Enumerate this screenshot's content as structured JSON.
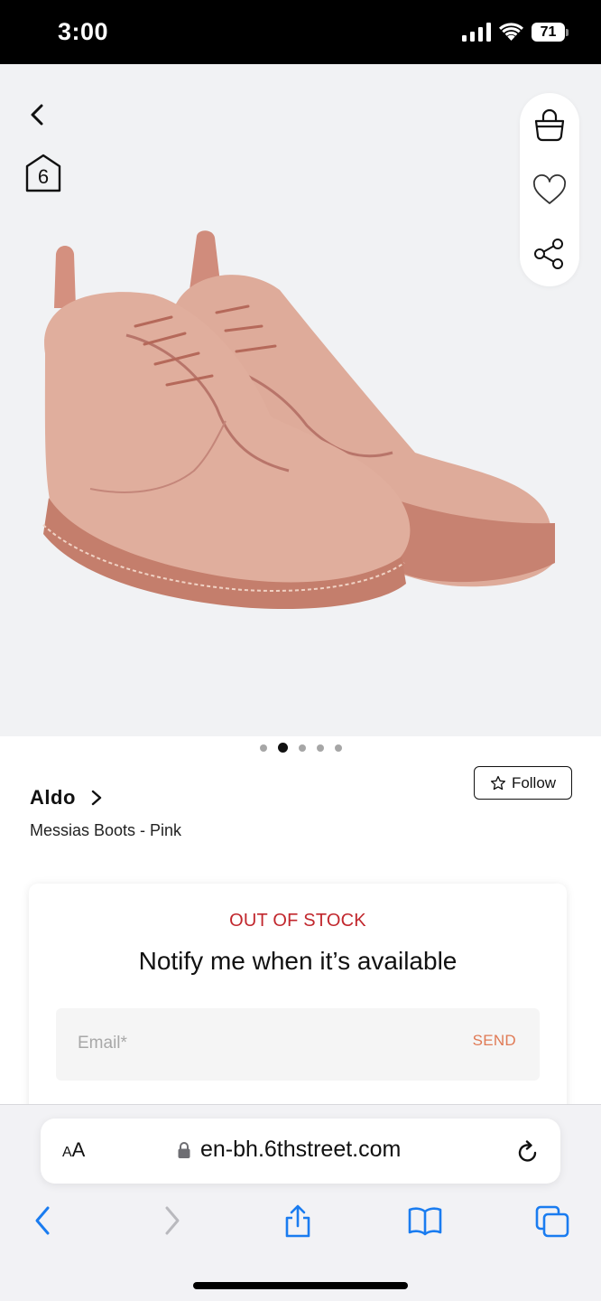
{
  "status_bar": {
    "time": "3:00",
    "battery": "71",
    "icons": [
      "signal-icon",
      "wifi-icon",
      "battery-icon"
    ]
  },
  "product_gallery": {
    "icons": [
      "back-icon",
      "6thstreet-logo-icon",
      "shopping-bag-icon",
      "heart-icon",
      "share-icon"
    ],
    "image": "pink-suede-chukka-boots",
    "pagination": {
      "total": 5,
      "active_index": 1
    }
  },
  "product": {
    "brand": "Aldo",
    "name": "Messias Boots - Pink",
    "follow_label": "Follow"
  },
  "notify": {
    "status": "OUT OF STOCK",
    "title": "Notify me when it’s available",
    "email_placeholder": "Email*",
    "email_value": "",
    "send_label": "SEND"
  },
  "browser": {
    "text_size_label_small": "A",
    "text_size_label_large": "A",
    "url": "en-bh.6thstreet.com",
    "icons": [
      "lock-icon",
      "reload-icon",
      "back-arrow-icon",
      "forward-arrow-icon",
      "share-icon",
      "bookmarks-icon",
      "tabs-icon"
    ]
  },
  "colors": {
    "out_of_stock": "#c1272d",
    "send": "#e07a55",
    "safari_blue": "#1a7cf0",
    "image_background": "#f1f2f4"
  }
}
